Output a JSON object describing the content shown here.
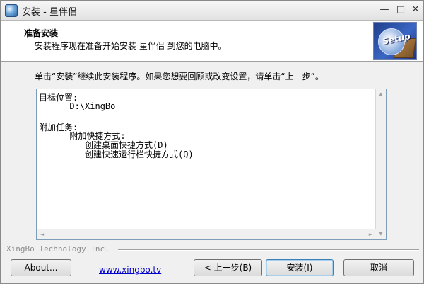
{
  "window": {
    "title": "安装 - 星伴侣",
    "controls": {
      "minimize": "—",
      "maximize": "□",
      "close": "✕"
    },
    "icon": "app-icon"
  },
  "header": {
    "title": "准备安装",
    "subtitle": "安装程序现在准备开始安装 星伴侣 到您的电脑中。",
    "logo_icon": "setup-logo-icon"
  },
  "instruction": "单击“安装”继续此安装程序。如果您想要回顾或改变设置，请单击“上一步”。",
  "memo": {
    "lines": [
      "目标位置:",
      "      D:\\XingBo",
      "",
      "附加任务:",
      "      附加快捷方式:",
      "         创建桌面快捷方式(D)",
      "         创建快速运行栏快捷方式(Q)"
    ],
    "scroll_up": "▲",
    "scroll_down": "▼",
    "scroll_left": "◄",
    "scroll_right": "►"
  },
  "brand": "XingBo Technology Inc.",
  "footer": {
    "about_label": "About...",
    "link_text": "www.xingbo.tv",
    "back_label": "< 上一步(B)",
    "install_label": "安装(I)",
    "cancel_label": "取消"
  }
}
